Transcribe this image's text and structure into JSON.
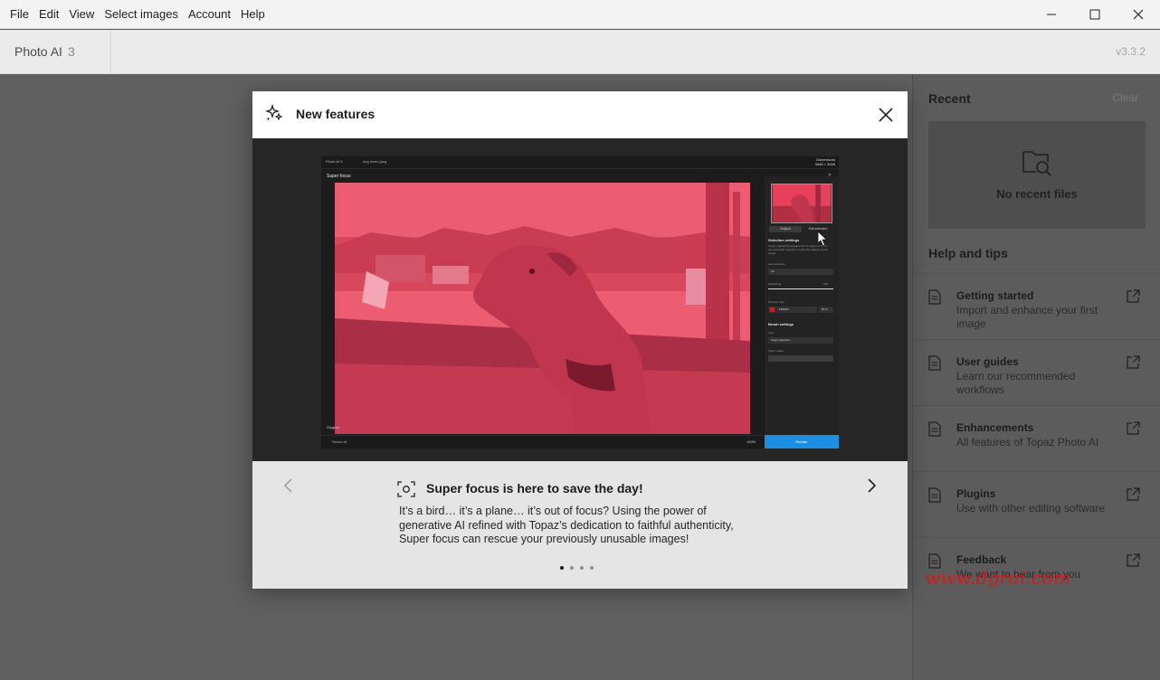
{
  "menubar": {
    "items": [
      "File",
      "Edit",
      "View",
      "Select images",
      "Account",
      "Help"
    ]
  },
  "header": {
    "app_name": "Photo AI",
    "app_major": "3",
    "version": "v3.3.2"
  },
  "right_panel": {
    "recent_title": "Recent",
    "clear_label": "Clear",
    "no_recent": "No recent files",
    "help_title": "Help and tips",
    "tips": [
      {
        "title": "Getting started",
        "desc": "Import and enhance your first image"
      },
      {
        "title": "User guides",
        "desc": "Learn our recommended workflows"
      },
      {
        "title": "Enhancements",
        "desc": "All features of Topaz Photo AI"
      },
      {
        "title": "Plugins",
        "desc": "Use with other editing software"
      },
      {
        "title": "Feedback",
        "desc": "We want to hear from you"
      }
    ]
  },
  "watermark": "www.dgrai.com",
  "modal": {
    "title": "New features",
    "feature_title": "Super focus is here to save the day!",
    "feature_desc": "It’s a bird… it’s a plane… it’s out of focus? Using the power of generative AI refined with Topaz’s dedication to faithful authenticity, Super focus can rescue your previously unusable images!",
    "dots": 4,
    "active_dot": 0
  },
  "preview": {
    "app_name": "Photo AI 3",
    "file_name": "dog insert.jpeg",
    "dimensions_label": "Dimensions",
    "dimensions_value": "3048 × 3048",
    "dialog_title": "Super focus",
    "original_label": "Original",
    "select_all": "Select all",
    "zoom": "100%",
    "tab_subject": "Subject",
    "tab_edit": "Edit selection",
    "selection_settings": "Selection settings",
    "selection_hint": "If your original photograph has an object of focus, use automatic selection to pick the subject of your image",
    "auto_selection": "Auto selection",
    "auto_value": "All",
    "feathering": "Feathering",
    "feathering_value": "100",
    "preview_color": "Preview color",
    "color_hex": "FB0000",
    "opacity": "60 %",
    "brush_settings": "Brush settings",
    "type_label": "Type",
    "type_value": "Object selection",
    "paint_erase": "Paint / erase",
    "render_label": "Render"
  },
  "colors": {
    "accent_blue": "#1d8fe0",
    "overlay_red": "#e8314a"
  }
}
